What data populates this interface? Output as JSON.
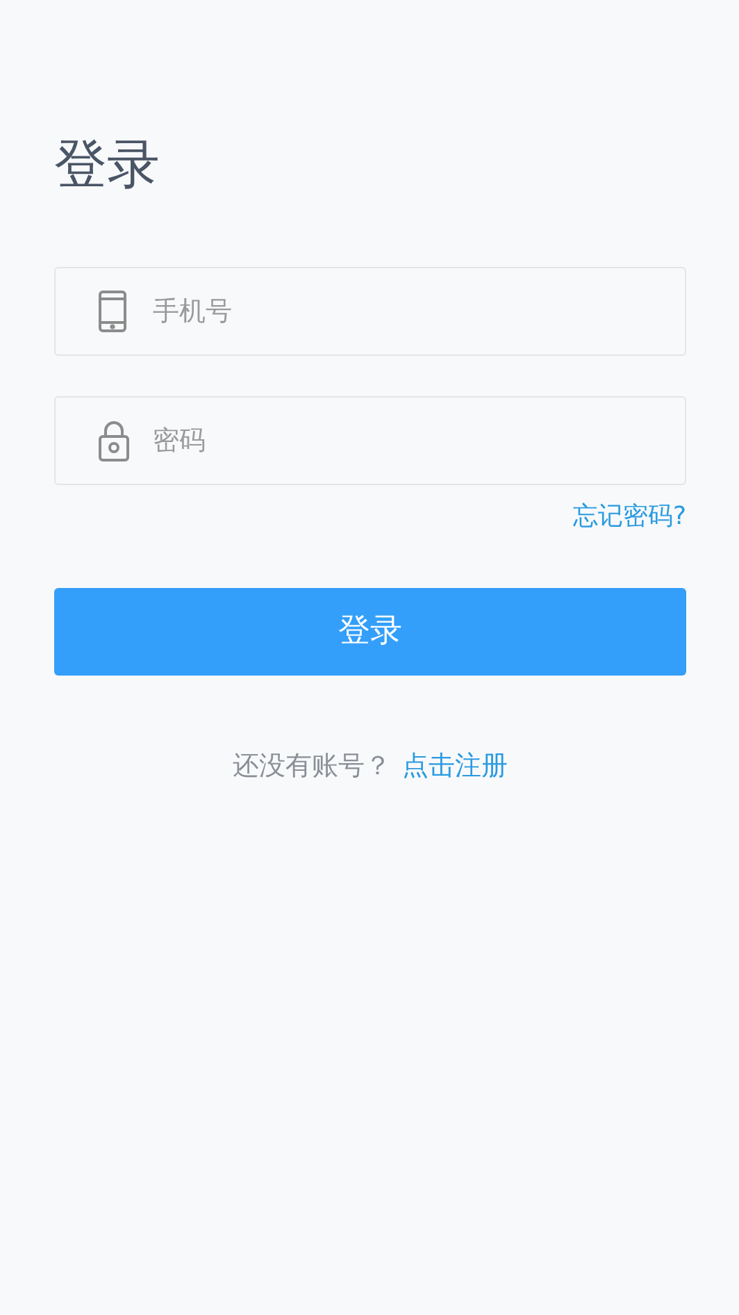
{
  "title": "登录",
  "fields": [
    {
      "kind": "phone",
      "placeholder": "手机号"
    },
    {
      "kind": "password",
      "placeholder": "密码"
    }
  ],
  "forgot_link": "忘记密码?",
  "login_button": "登录",
  "register": {
    "prompt": "还没有账号？",
    "link": "点击注册"
  }
}
